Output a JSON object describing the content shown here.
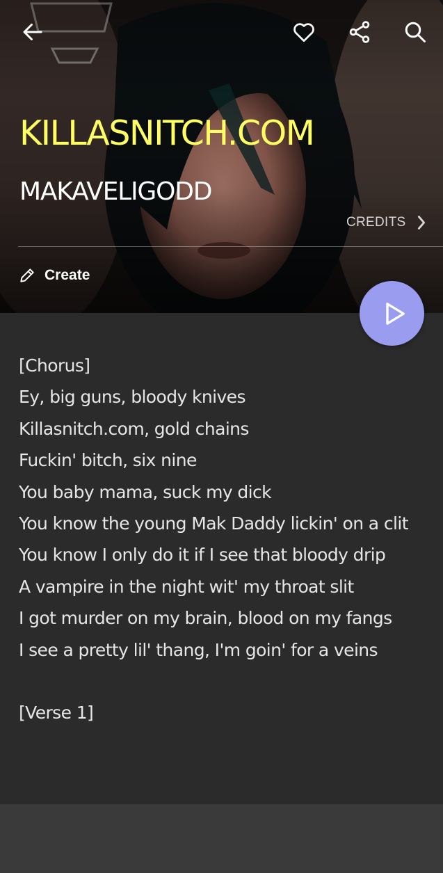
{
  "header": {
    "song_title": "KILLASNITCH.COM",
    "artist": "MAKAVELIGODD",
    "credits_label": "CREDITS",
    "create_label": "Create",
    "icons": [
      "back-arrow-icon",
      "heart-icon",
      "share-icon",
      "search-icon",
      "chevron-right-icon",
      "pencil-icon",
      "play-icon"
    ]
  },
  "colors": {
    "title": "#ffff64",
    "play_button": "#9a9cf0",
    "lyrics_bg": "#2b2b2b"
  },
  "lyrics": {
    "lines": [
      "[Chorus]",
      "Ey, big guns, bloody knives",
      "Killasnitch.com, gold chains",
      "Fuckin' bitch, six nine",
      "You baby mama, suck my dick",
      "You know the young Mak Daddy lickin' on a clit",
      "You know I only do it if I see that bloody drip",
      "A vampire in the night wit' my throat slit",
      "I got murder on my brain, blood on my fangs",
      "I see a pretty lil' thang, I'm goin' for a veins",
      "",
      "[Verse 1]"
    ]
  }
}
